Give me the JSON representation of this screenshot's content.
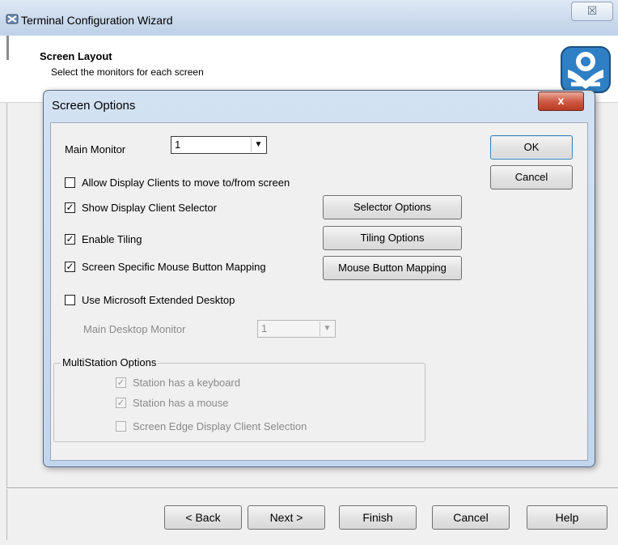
{
  "outer": {
    "title": "Terminal Configuration Wizard",
    "close_glyph": "☒",
    "header_title": "Screen Layout",
    "header_subtitle": "Select the monitors for each screen",
    "logo_icon": "thinmanager-logo-icon",
    "buttons": {
      "back": "< Back",
      "next": "Next >",
      "finish": "Finish",
      "cancel": "Cancel",
      "help": "Help"
    }
  },
  "dialog": {
    "title": "Screen Options",
    "close_glyph": "x",
    "main_monitor_label": "Main Monitor",
    "main_monitor_value": "1",
    "ok_label": "OK",
    "cancel_label": "Cancel",
    "options": {
      "allow_move": {
        "label": "Allow Display Clients to move to/from screen",
        "checked": false
      },
      "show_selector": {
        "label": "Show Display Client Selector",
        "checked": true
      },
      "enable_tiling": {
        "label": "Enable Tiling",
        "checked": true
      },
      "mouse_mapping": {
        "label": "Screen Specific Mouse Button Mapping",
        "checked": true
      },
      "extended_desktop": {
        "label": "Use Microsoft Extended Desktop",
        "checked": false
      }
    },
    "selector_options_label": "Selector Options",
    "tiling_options_label": "Tiling Options",
    "mouse_mapping_button_label": "Mouse Button Mapping",
    "main_desktop_monitor_label": "Main Desktop Monitor",
    "main_desktop_monitor_value": "1",
    "multistation": {
      "title": "MultiStation Options",
      "has_keyboard": {
        "label": "Station has a keyboard",
        "checked": true
      },
      "has_mouse": {
        "label": "Station has a mouse",
        "checked": true
      },
      "edge_selection": {
        "label": "Screen Edge Display Client Selection",
        "checked": false
      }
    },
    "check_glyph": "✓",
    "combo_arrow_glyph": "▼"
  },
  "colors": {
    "title_gradient": "#c9d9ec",
    "dialog_frame": "#c1d5ec",
    "close_red": "#cf5b45",
    "face": "#f0f0f0"
  }
}
